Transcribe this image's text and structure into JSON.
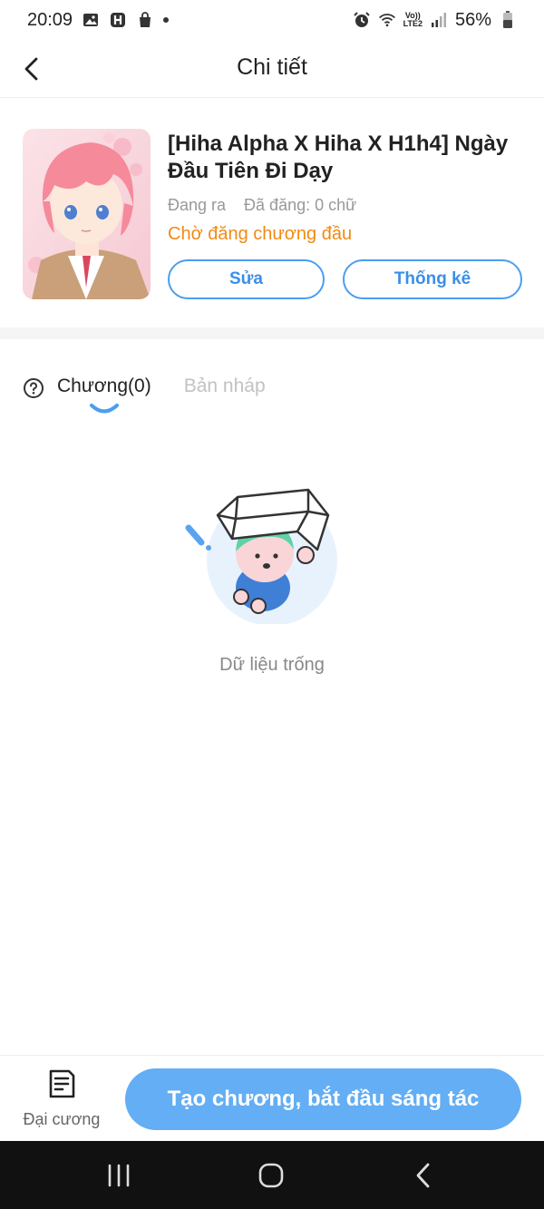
{
  "status_bar": {
    "time": "20:09",
    "battery": "56%",
    "volte_line1": "Vo))",
    "volte_line2": "LTE2"
  },
  "header": {
    "title": "Chi tiết"
  },
  "book": {
    "title": "[Hiha Alpha X Hiha X H1h4] Ngày Đầu Tiên Đi Dạy",
    "state": "Đang ra",
    "posted": "Đã đăng: 0 chữ",
    "status": "Chờ đăng chương đầu",
    "edit_label": "Sửa",
    "stats_label": "Thống kê"
  },
  "tabs": {
    "chapters": "Chương(0)",
    "drafts": "Bản nháp"
  },
  "empty": {
    "text": "Dữ liệu trống"
  },
  "bottom": {
    "outline_label": "Đại cương",
    "create_label": "Tạo chương, bắt đầu sáng tác"
  },
  "colors": {
    "accent": "#4a9ef0",
    "button_fill": "#63aef4",
    "status_orange": "#f08a13"
  },
  "icons": [
    "back-icon",
    "help-icon",
    "outline-icon",
    "recents-icon",
    "home-icon",
    "nav-back-icon",
    "alarm-icon",
    "wifi-icon",
    "signal-icon",
    "battery-icon"
  ]
}
